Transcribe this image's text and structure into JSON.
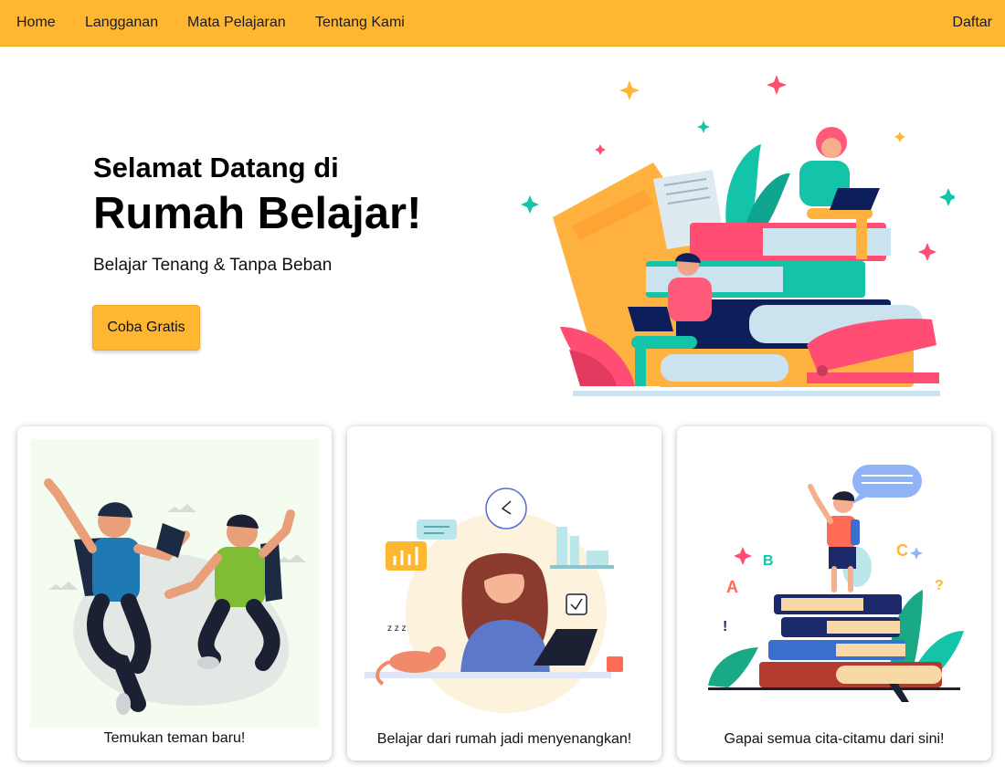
{
  "nav": {
    "links": [
      "Home",
      "Langganan",
      "Mata Pelajaran",
      "Tentang Kami"
    ],
    "register_label": "Daftar"
  },
  "hero": {
    "title_line1": "Selamat Datang di",
    "title_line2": "Rumah Belajar!",
    "subtitle": "Belajar Tenang & Tanpa Beban",
    "cta_label": "Coba Gratis"
  },
  "cards": [
    {
      "caption": "Temukan teman baru!"
    },
    {
      "caption": "Belajar dari rumah jadi menyenangkan!"
    },
    {
      "caption": "Gapai semua cita-citamu dari sini!"
    }
  ],
  "colors": {
    "nav_bg": "#ffb732",
    "cta_bg": "#ffb732",
    "accent_pink": "#ff4d74",
    "accent_teal": "#13c4a8"
  }
}
